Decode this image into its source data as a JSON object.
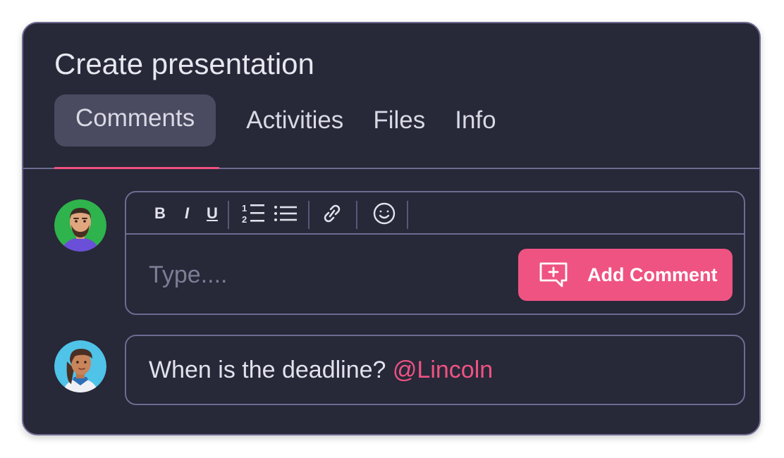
{
  "title": "Create presentation",
  "tabs": [
    {
      "label": "Comments",
      "active": true
    },
    {
      "label": "Activities",
      "active": false
    },
    {
      "label": "Files",
      "active": false
    },
    {
      "label": "Info",
      "active": false
    }
  ],
  "editor": {
    "toolbar": {
      "bold": "B",
      "italic": "I",
      "underline": "U",
      "items": [
        "bold-icon",
        "italic-icon",
        "underline-icon",
        "numbered-list-icon",
        "bullet-list-icon",
        "link-icon",
        "emoji-icon"
      ]
    },
    "placeholder": "Type....",
    "add_button_label": "Add Comment",
    "add_button_icon": "comment-add-icon"
  },
  "comment": {
    "text": "When is the deadline? ",
    "mention": "@Lincoln"
  },
  "colors": {
    "card_bg": "#272838",
    "border": "#6e6b92",
    "accent": "#ef5382",
    "active_tab_bg": "#4a4a61"
  }
}
